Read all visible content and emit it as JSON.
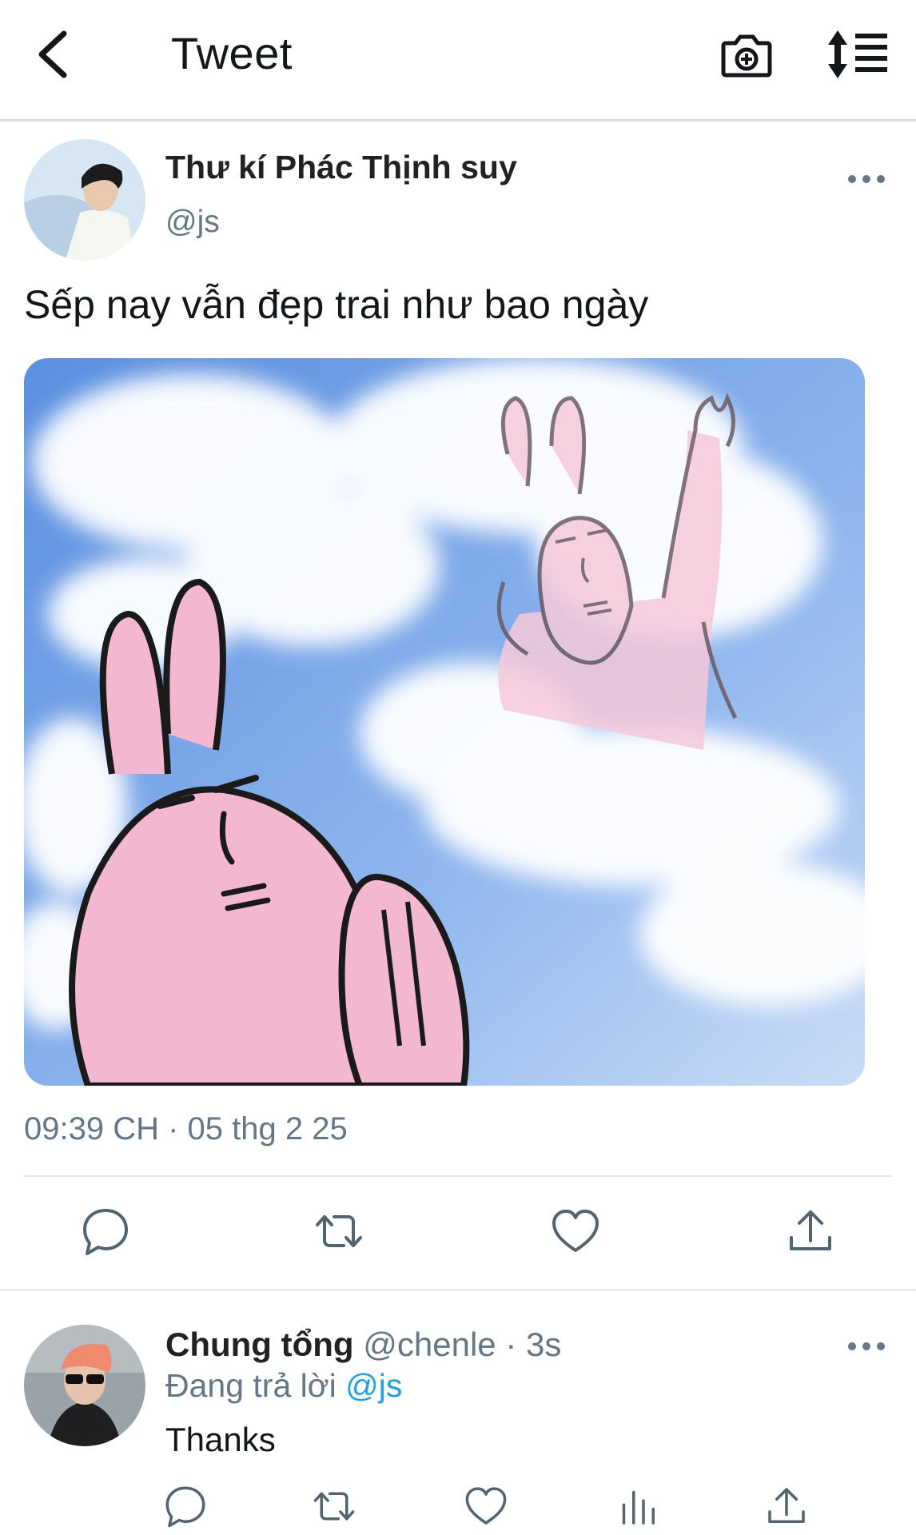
{
  "header": {
    "title": "Tweet",
    "back_icon": "chevron-left-icon",
    "camera_icon": "camera-plus-icon",
    "sort_icon": "sort-list-icon"
  },
  "tweet": {
    "author_name": "Thư kí Phác Thịnh suy",
    "author_handle": "@js",
    "text": "Sếp nay vẫn đẹp trai như bao ngày",
    "timestamp": "09:39 CH · 05 thg 2 25",
    "media_description_icon": "image-pink-rabbits"
  },
  "reply": {
    "author_name": "Chung tổng",
    "author_handle": "@chenle",
    "time_sep": " · ",
    "time": "3s",
    "replying_prefix": "Đang trả lời ",
    "replying_to": "@js",
    "text": "Thanks"
  },
  "colors": {
    "accent": "#1da1f2",
    "muted": "#657786",
    "icon": "#536471",
    "divider": "#e1e8ed"
  }
}
